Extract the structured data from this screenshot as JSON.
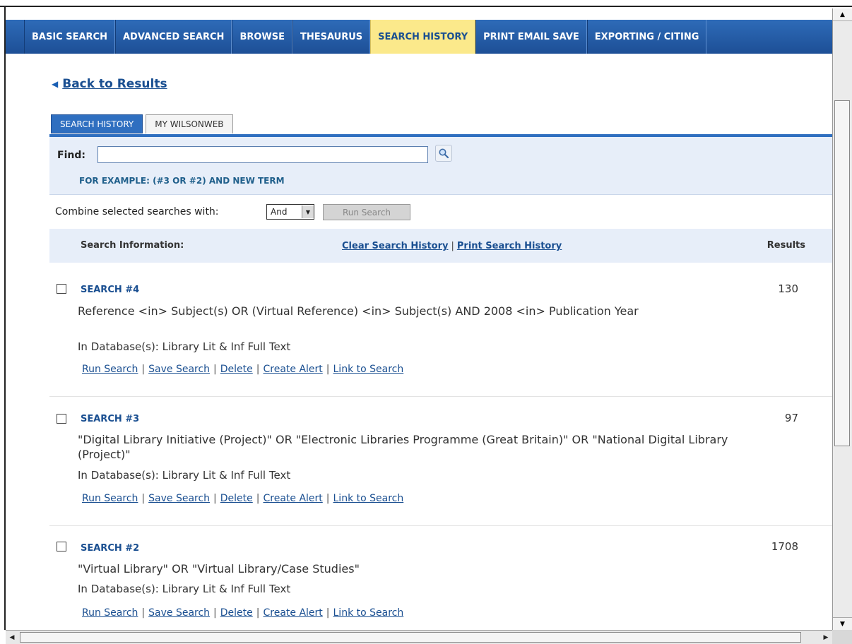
{
  "nav": {
    "tabs": [
      {
        "label": "BASIC SEARCH"
      },
      {
        "label": "ADVANCED SEARCH"
      },
      {
        "label": "BROWSE"
      },
      {
        "label": "THESAURUS"
      },
      {
        "label": "SEARCH HISTORY",
        "active": true
      },
      {
        "label": "PRINT EMAIL SAVE"
      },
      {
        "label": "EXPORTING / CITING"
      }
    ],
    "active_color": "#fbe98b",
    "bar_color": "#2a62ad"
  },
  "back_link": "Back to Results",
  "inner_tabs": {
    "search_history": "SEARCH HISTORY",
    "my_wilsonweb": "MY WILSONWEB"
  },
  "find": {
    "label": "Find:",
    "value": "",
    "example": "FOR EXAMPLE: (#3 OR #2) AND NEW TERM"
  },
  "combine": {
    "label": "Combine selected searches with:",
    "selected": "And",
    "run_button": "Run Search"
  },
  "header": {
    "info": "Search Information:",
    "clear": "Clear Search History",
    "separator": "|",
    "print": "Print Search History",
    "results": "Results"
  },
  "entries": [
    {
      "title": "SEARCH #4",
      "query": "Reference <in> Subject(s) OR (Virtual Reference) <in> Subject(s) AND 2008 <in> Publication Year",
      "database": "In Database(s): Library Lit & Inf Full Text",
      "results": "130"
    },
    {
      "title": "SEARCH #3",
      "query": "\"Digital Library Initiative (Project)\" OR \"Electronic Libraries Programme (Great Britain)\" OR \"National Digital Library (Project)\"",
      "database": "In Database(s): Library Lit & Inf Full Text",
      "results": "97"
    },
    {
      "title": "SEARCH #2",
      "query": "\"Virtual Library\" OR \"Virtual Library/Case Studies\"",
      "database": "In Database(s): Library Lit & Inf Full Text",
      "results": "1708"
    }
  ],
  "actions": {
    "run": "Run Search",
    "save": "Save Search",
    "delete": "Delete",
    "alert": "Create Alert",
    "link": "Link to Search",
    "sep": "|"
  },
  "icons": {
    "back": "triangle-left-icon",
    "find_button": "magnifier-icon"
  }
}
